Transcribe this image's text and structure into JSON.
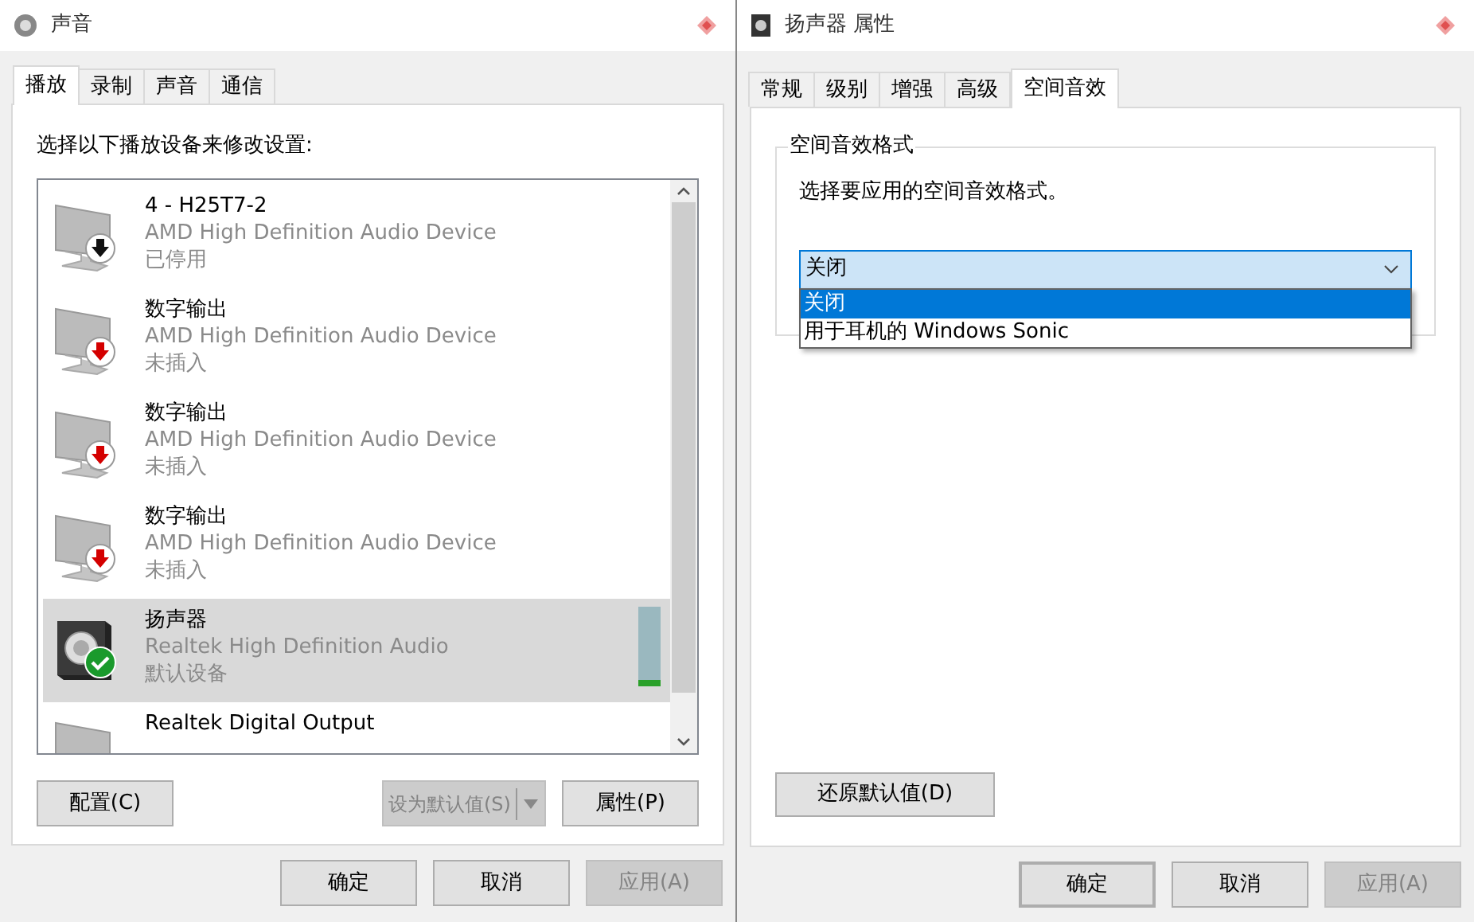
{
  "sound_window": {
    "title": "声音",
    "tabs": [
      {
        "label": "播放",
        "selected": true
      },
      {
        "label": "录制",
        "selected": false
      },
      {
        "label": "声音",
        "selected": false
      },
      {
        "label": "通信",
        "selected": false
      }
    ],
    "instruction": "选择以下播放设备来修改设置:",
    "devices": [
      {
        "kind": "disabled",
        "name": "4 - H25T7-2",
        "description": "AMD High Definition Audio Device",
        "status": "已停用",
        "selected": false
      },
      {
        "kind": "unplugged",
        "name": "数字输出",
        "description": "AMD High Definition Audio Device",
        "status": "未插入",
        "selected": false
      },
      {
        "kind": "unplugged",
        "name": "数字输出",
        "description": "AMD High Definition Audio Device",
        "status": "未插入",
        "selected": false
      },
      {
        "kind": "unplugged",
        "name": "数字输出",
        "description": "AMD High Definition Audio Device",
        "status": "未插入",
        "selected": false
      },
      {
        "kind": "default",
        "name": "扬声器",
        "description": "Realtek High Definition Audio",
        "status": "默认设备",
        "selected": true,
        "level": 0.08
      },
      {
        "kind": "plain",
        "name": "Realtek Digital Output",
        "selected": false
      }
    ],
    "buttons": [
      {
        "label": "配置(C)",
        "disabled": false
      },
      {
        "label": "设为默认值(S)",
        "disabled": true
      },
      {
        "label": "属性(P)",
        "disabled": false
      }
    ],
    "footer_buttons": [
      {
        "label": "确定",
        "disabled": false,
        "default": false
      },
      {
        "label": "取消",
        "disabled": false,
        "default": false
      },
      {
        "label": "应用(A)",
        "disabled": true,
        "default": false
      }
    ]
  },
  "properties_window": {
    "title": "扬声器 属性",
    "tabs": [
      {
        "label": "常规",
        "selected": false
      },
      {
        "label": "级别",
        "selected": false
      },
      {
        "label": "增强",
        "selected": false
      },
      {
        "label": "高级",
        "selected": false
      },
      {
        "label": "空间音效",
        "selected": true
      }
    ],
    "group_title": "空间音效格式",
    "instruction": "选择要应用的空间音效格式。",
    "format_select": {
      "value": "关闭",
      "expanded": true,
      "options": [
        {
          "label": "关闭",
          "selected": true
        },
        {
          "label": "用于耳机的 Windows Sonic",
          "selected": false
        }
      ]
    },
    "restore_button": "还原默认值(D)",
    "footer_buttons": [
      {
        "label": "确定",
        "disabled": false,
        "default": true
      },
      {
        "label": "取消",
        "disabled": false,
        "default": false
      },
      {
        "label": "应用(A)",
        "disabled": true,
        "default": false
      }
    ]
  }
}
